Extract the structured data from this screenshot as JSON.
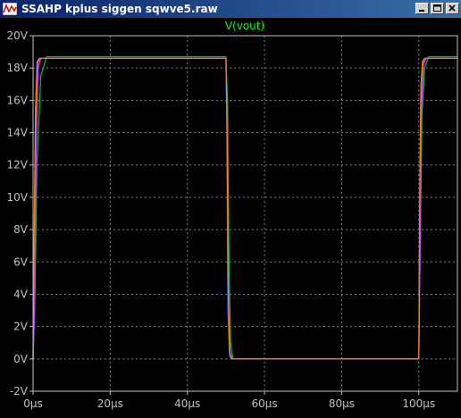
{
  "window": {
    "title": "SSAHP kplus siggen sqwve5.raw",
    "minimize_icon": "minimize-icon",
    "maximize_icon": "maximize-icon",
    "close_icon": "close-icon"
  },
  "colors": {
    "background": "#000000",
    "grid": "#808080",
    "axis_text": "#c0c0c0",
    "trace_title": "#00ff00"
  },
  "chart_data": {
    "type": "line",
    "title": "V(vout)",
    "xlabel": "",
    "ylabel": "",
    "xlim": [
      0,
      110
    ],
    "ylim": [
      -2,
      20
    ],
    "grid": true,
    "x_ticks": [
      "0µs",
      "20µs",
      "40µs",
      "60µs",
      "80µs",
      "100µs"
    ],
    "x_tick_values": [
      0,
      20,
      40,
      60,
      80,
      100
    ],
    "y_ticks": [
      "-2V",
      "0V",
      "2V",
      "4V",
      "6V",
      "8V",
      "10V",
      "12V",
      "14V",
      "16V",
      "18V",
      "20V"
    ],
    "y_tick_values": [
      -2,
      0,
      2,
      4,
      6,
      8,
      10,
      12,
      14,
      16,
      18,
      20
    ],
    "series": [
      {
        "color": "#00c040",
        "x": [
          0,
          0.5,
          1,
          2,
          3.5,
          50.0,
          50.4,
          50.8,
          51.2,
          51.8,
          100.0,
          100.4,
          100.8,
          101.5,
          102.5,
          110
        ],
        "y": [
          0,
          4,
          12,
          17.5,
          18.7,
          18.7,
          16,
          6,
          1,
          0,
          0,
          8,
          15,
          18,
          18.7,
          18.7
        ]
      },
      {
        "color": "#ff4080",
        "x": [
          0,
          0.3,
          0.7,
          1.2,
          1.8,
          50.0,
          50.3,
          50.6,
          51.0,
          51.5,
          100.0,
          100.3,
          100.6,
          101.0,
          101.6,
          110
        ],
        "y": [
          0,
          6,
          14,
          18.3,
          18.6,
          18.6,
          14,
          4,
          0.4,
          0,
          0,
          10,
          16,
          18.3,
          18.6,
          18.6
        ]
      },
      {
        "color": "#4060ff",
        "x": [
          0,
          0.2,
          0.6,
          1.0,
          1.6,
          50.0,
          50.2,
          50.5,
          50.9,
          51.4,
          100.0,
          100.2,
          100.5,
          100.9,
          101.4,
          110
        ],
        "y": [
          0,
          5,
          15,
          18.4,
          18.6,
          18.6,
          15,
          3,
          0.2,
          0,
          0,
          9,
          16.5,
          18.4,
          18.6,
          18.6
        ]
      },
      {
        "color": "#c040ff",
        "x": [
          0,
          0.4,
          0.8,
          1.3,
          2.0,
          50.0,
          50.35,
          50.7,
          51.1,
          51.7,
          100.0,
          100.35,
          100.7,
          101.2,
          101.9,
          110
        ],
        "y": [
          0,
          3,
          13,
          18.0,
          18.6,
          18.6,
          13,
          2.5,
          0.3,
          0,
          0,
          7,
          15.5,
          18.2,
          18.6,
          18.6
        ]
      },
      {
        "color": "#ff8000",
        "x": [
          0,
          0.25,
          0.65,
          1.1,
          1.7,
          50.0,
          50.25,
          50.55,
          50.95,
          51.5,
          100.0,
          100.25,
          100.55,
          100.95,
          101.5,
          110
        ],
        "y": [
          0,
          7,
          15.5,
          18.4,
          18.6,
          18.6,
          15.5,
          5,
          0.5,
          0,
          0,
          11,
          17,
          18.4,
          18.6,
          18.6
        ]
      }
    ]
  }
}
